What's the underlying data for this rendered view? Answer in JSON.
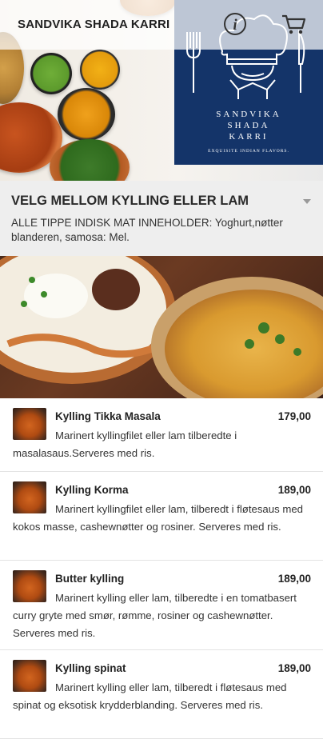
{
  "header": {
    "title": "SANDVIKA SHADA KARRI",
    "info_icon": "info-circle-icon",
    "cart_icon": "shopping-cart-icon"
  },
  "logo": {
    "name_line1": "SANDVIKA",
    "name_line2": "SHADA",
    "name_line3": "KARRI",
    "tagline": "EXQUISITE INDIAN FLAVORS.",
    "background": "#143469"
  },
  "category": {
    "title": "VELG MELLOM KYLLING ELLER LAM",
    "description": "ALLE TIPPE INDISK MAT INNEHOLDER: Yoghurt,nøtter blanderen, samosa: Mel.",
    "dropdown_icon": "caret-down-icon"
  },
  "menu_items": [
    {
      "name": "Kylling Tikka Masala",
      "price": "179,00",
      "description": "Marinert kyllingfilet eller lam tilberedte i masalasaus.Serveres med ris."
    },
    {
      "name": "Kylling Korma",
      "price": "189,00",
      "description": "Marinert kyllingfilet eller lam, tilberedt i fløtesaus med kokos masse, cashewnøtter og rosiner. Serveres med ris."
    },
    {
      "name": "Butter kylling",
      "price": "189,00",
      "description": "Marinert kylling eller lam, tilberedte i en tomatbasert curry gryte med smør, rømme, rosiner og cashewnøtter. Serveres med ris."
    },
    {
      "name": "Kylling spinat",
      "price": "189,00",
      "description": "Marinert kylling eller lam, tilberedt i fløtesaus med spinat og eksotisk krydderblanding. Serveres med ris."
    }
  ]
}
